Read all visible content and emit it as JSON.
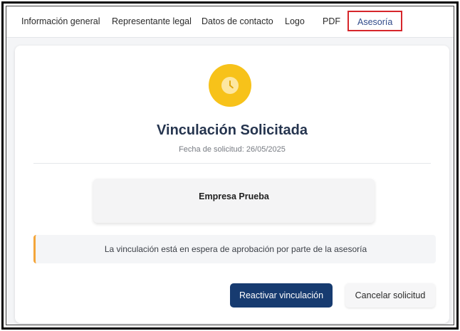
{
  "tabs": [
    {
      "label": "Información general"
    },
    {
      "label": "Representante legal"
    },
    {
      "label": "Datos de contacto"
    },
    {
      "label": "Logo"
    },
    {
      "label": "PDF"
    },
    {
      "label": "Asesoría",
      "active": true
    }
  ],
  "status": {
    "icon": "clock-icon",
    "title": "Vinculación Solicitada",
    "date_line": "Fecha de solicitud: 26/05/2025"
  },
  "company": {
    "name": "Empresa Prueba"
  },
  "alert": {
    "message": "La vinculación está en espera de aprobación por parte de la asesoría",
    "accent_color": "#f4a53a"
  },
  "actions": {
    "reactivate_label": "Reactivar vinculación",
    "cancel_label": "Cancelar solicitud"
  },
  "colors": {
    "primary": "#173b70",
    "active_tab_border": "#d6262b",
    "status_icon": "#f7c21a"
  }
}
